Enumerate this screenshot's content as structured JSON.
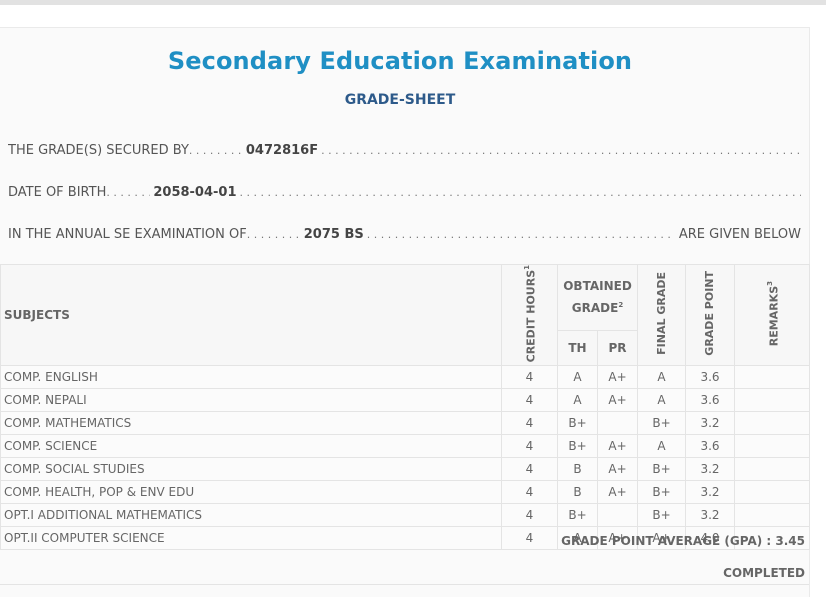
{
  "header": {
    "title": "Secondary Education Examination",
    "subtitle": "GRADE-SHEET"
  },
  "student": {
    "secured_by_label": "THE GRADE(S) SECURED BY",
    "symbol_no": "0472816F",
    "dob_label": "DATE OF BIRTH",
    "dob": "2058-04-01",
    "exam_label": "IN THE ANNUAL SE EXAMINATION OF",
    "exam_year": "2075 BS",
    "exam_suffix": "ARE GIVEN BELOW"
  },
  "table": {
    "headers": {
      "subjects": "SUBJECTS",
      "credit_hours": "CREDIT HOURS",
      "credit_sup": "1",
      "obtained_grade": "OBTAINED GRADE",
      "obtained_sup": "2",
      "th": "TH",
      "pr": "PR",
      "final_grade": "FINAL GRADE",
      "grade_point": "GRADE POINT",
      "remarks": "REMARKS",
      "remarks_sup": "3"
    },
    "rows": [
      {
        "subject": "COMP. ENGLISH",
        "credit": "4",
        "th": "A",
        "pr": "A+",
        "final": "A",
        "gp": "3.6",
        "remarks": ""
      },
      {
        "subject": "COMP. NEPALI",
        "credit": "4",
        "th": "A",
        "pr": "A+",
        "final": "A",
        "gp": "3.6",
        "remarks": ""
      },
      {
        "subject": "COMP. MATHEMATICS",
        "credit": "4",
        "th": "B+",
        "pr": "",
        "final": "B+",
        "gp": "3.2",
        "remarks": ""
      },
      {
        "subject": "COMP. SCIENCE",
        "credit": "4",
        "th": "B+",
        "pr": "A+",
        "final": "A",
        "gp": "3.6",
        "remarks": ""
      },
      {
        "subject": "COMP. SOCIAL STUDIES",
        "credit": "4",
        "th": "B",
        "pr": "A+",
        "final": "B+",
        "gp": "3.2",
        "remarks": ""
      },
      {
        "subject": "COMP. HEALTH, POP & ENV EDU",
        "credit": "4",
        "th": "B",
        "pr": "A+",
        "final": "B+",
        "gp": "3.2",
        "remarks": ""
      },
      {
        "subject": "OPT.I ADDITIONAL MATHEMATICS",
        "credit": "4",
        "th": "B+",
        "pr": "",
        "final": "B+",
        "gp": "3.2",
        "remarks": ""
      },
      {
        "subject": "OPT.II COMPUTER SCIENCE",
        "credit": "4",
        "th": "A",
        "pr": "A+",
        "final": "A+",
        "gp": "4.0",
        "remarks": ""
      }
    ]
  },
  "summary": {
    "gpa_label": "GRADE POINT AVERAGE (GPA) : 3.45",
    "status": "COMPLETED"
  },
  "colors": {
    "title": "#1f8fc4",
    "subtitle": "#2d5a8a",
    "text": "#555555",
    "border": "#e4e4e4"
  }
}
